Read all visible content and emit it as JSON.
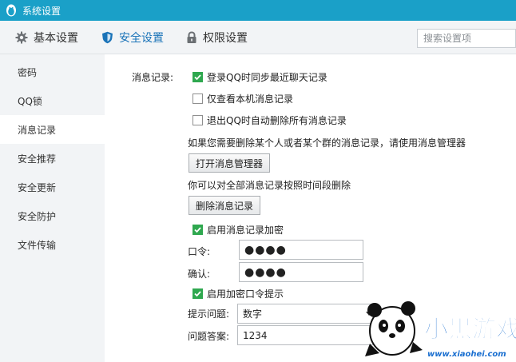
{
  "window": {
    "title": "系统设置"
  },
  "toolbar": {
    "tabs": [
      {
        "label": "基本设置",
        "icon": "gear-icon"
      },
      {
        "label": "安全设置",
        "icon": "shield-icon"
      },
      {
        "label": "权限设置",
        "icon": "lock-icon"
      }
    ],
    "search_placeholder": "搜索设置项"
  },
  "sidebar": {
    "items": [
      {
        "label": "密码"
      },
      {
        "label": "QQ锁"
      },
      {
        "label": "消息记录"
      },
      {
        "label": "安全推荐"
      },
      {
        "label": "安全更新"
      },
      {
        "label": "安全防护"
      },
      {
        "label": "文件传输"
      }
    ],
    "active_index": 2
  },
  "main": {
    "section_label": "消息记录:",
    "options": [
      {
        "label": "登录QQ时同步最近聊天记录",
        "checked": true
      },
      {
        "label": "仅查看本机消息记录",
        "checked": false
      },
      {
        "label": "退出QQ时自动删除所有消息记录",
        "checked": false
      }
    ],
    "delete_hint": "如果您需要删除某个人或者某个群的消息记录，请使用消息管理器",
    "open_manager_button": "打开消息管理器",
    "delete_by_time_hint": "你可以对全部消息记录按照时间段删除",
    "delete_records_button": "删除消息记录",
    "encrypt": {
      "label": "启用消息记录加密",
      "checked": true
    },
    "password_label": "口令:",
    "password_value": "●●●●",
    "confirm_label": "确认:",
    "confirm_value": "●●●●",
    "hint_enable": {
      "label": "启用加密口令提示",
      "checked": true
    },
    "question_label": "提示问题:",
    "question_value": "数字",
    "answer_label": "问题答案:",
    "answer_value": "1234"
  },
  "watermark": {
    "brand": "小黑游戏",
    "url": "www.xiaohei.com"
  },
  "colors": {
    "titlebar": "#1aa0c8",
    "accent": "#1a73b8",
    "check": "#2fa84f",
    "brand": "#1a6fd0"
  }
}
